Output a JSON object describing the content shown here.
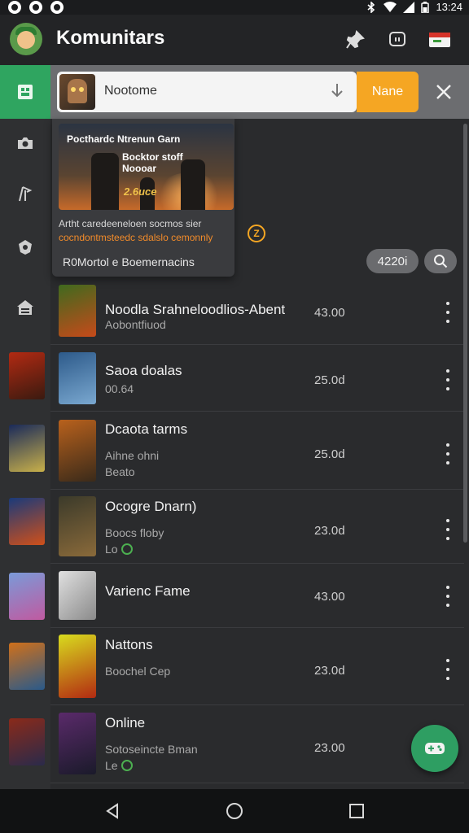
{
  "status_bar": {
    "time": "13:24"
  },
  "app_bar": {
    "title": "Komunitars",
    "icons": [
      "avatar",
      "pin-icon",
      "chat-icon",
      "gift-card-icon"
    ]
  },
  "search": {
    "query": "Nootome",
    "button_label": "Nane"
  },
  "featured": {
    "art_title": "Pocthardc Ntrenun Garn",
    "art_subtitle": "Bocktor stoff Noooar",
    "art_price": "2.6uce",
    "description_line1": "Artht caredeeneloen socmos sier",
    "description_line2": "cocndontmsteedc sdalslo cemonnly",
    "link_label": "R0Mortol e Boemernacins",
    "badge": "Z"
  },
  "filter": {
    "count_label": "4220i"
  },
  "rail": {
    "items": [
      "home",
      "camera",
      "route",
      "shield",
      "store"
    ]
  },
  "games": [
    {
      "title": "Noodla Srahneloodlios-Abent",
      "subtitle": "Aobontfiuod",
      "extra": "",
      "price": "43.00",
      "colors": [
        "#3f6a1e",
        "#c64a1a"
      ]
    },
    {
      "title": "Saoa doalas",
      "subtitle": "00.64",
      "extra": "",
      "price": "25.0d",
      "colors": [
        "#2d5a8a",
        "#7aa8d0"
      ]
    },
    {
      "title": "Dcaota tarms",
      "subtitle": "Aihne ohni",
      "extra": "Beato",
      "price": "25.0d",
      "colors": [
        "#b8611c",
        "#3a2a1a"
      ]
    },
    {
      "title": "Ocogre Dnarn)",
      "subtitle": "Boocs floby",
      "extra": "Lo",
      "price": "23.0d",
      "colors": [
        "#3b3a2a",
        "#8a6a3a"
      ]
    },
    {
      "title": "Varienc Fame",
      "subtitle": "",
      "extra": "",
      "price": "43.00",
      "colors": [
        "#cfcfcf",
        "#8a8a8a"
      ]
    },
    {
      "title": "Nattons",
      "subtitle": "Boochel Cep",
      "extra": "",
      "price": "23.0d",
      "colors": [
        "#d8dc1e",
        "#b22a12"
      ]
    },
    {
      "title": "Online",
      "subtitle": "Sotoseincte Bman",
      "extra": "Le",
      "price": "23.00",
      "colors": [
        "#5a2a6a",
        "#1a1a2a"
      ]
    }
  ]
}
